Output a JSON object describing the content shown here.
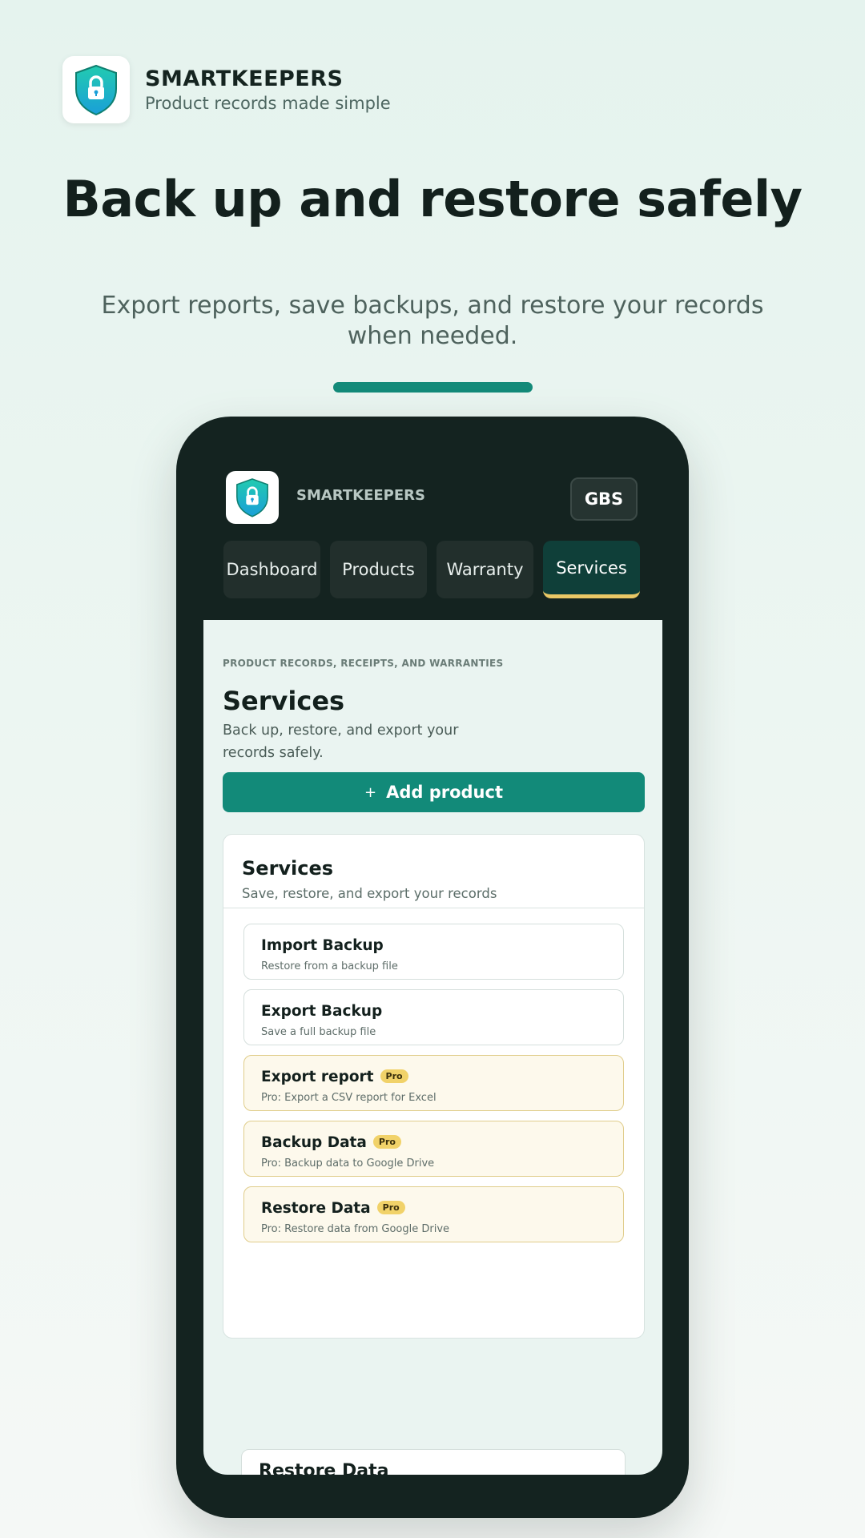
{
  "brand": {
    "name": "SMARTKEEPERS",
    "tagline": "Product records made simple",
    "logo_icon": "shield-lock-icon"
  },
  "hero": {
    "title": "Back up and restore safely",
    "subtitle": "Export reports, save backups, and restore your records when needed."
  },
  "app": {
    "name": "SMARTKEEPERS",
    "account_button": "GBS",
    "tabs": [
      {
        "label": "Dashboard",
        "active": false
      },
      {
        "label": "Products",
        "active": false
      },
      {
        "label": "Warranty",
        "active": false
      },
      {
        "label": "Services",
        "active": true
      }
    ],
    "eyebrow": "PRODUCT RECORDS, RECEIPTS, AND WARRANTIES",
    "page_title": "Services",
    "page_description": "Back up, restore, and export your records safely.",
    "add_button": {
      "icon": "+",
      "label": "Add product"
    },
    "services_card": {
      "title": "Services",
      "subtitle": "Save, restore, and export your records",
      "items": [
        {
          "title": "Import Backup",
          "description": "Restore from a backup file",
          "pro": false
        },
        {
          "title": "Export Backup",
          "description": "Save a full backup file",
          "pro": false
        },
        {
          "title": "Export report",
          "description": "Pro: Export a CSV report for Excel",
          "pro": true,
          "badge": "Pro"
        },
        {
          "title": "Backup Data",
          "description": "Pro: Backup data to Google Drive",
          "pro": true,
          "badge": "Pro"
        },
        {
          "title": "Restore Data",
          "description": "Pro: Restore data from Google Drive",
          "pro": true,
          "badge": "Pro"
        }
      ]
    },
    "peek_item_title": "Restore Data"
  },
  "colors": {
    "accent": "#128a79",
    "phone_frame": "#142320",
    "active_tab_underline": "#e9c866",
    "pro_badge": "#f1d269"
  }
}
